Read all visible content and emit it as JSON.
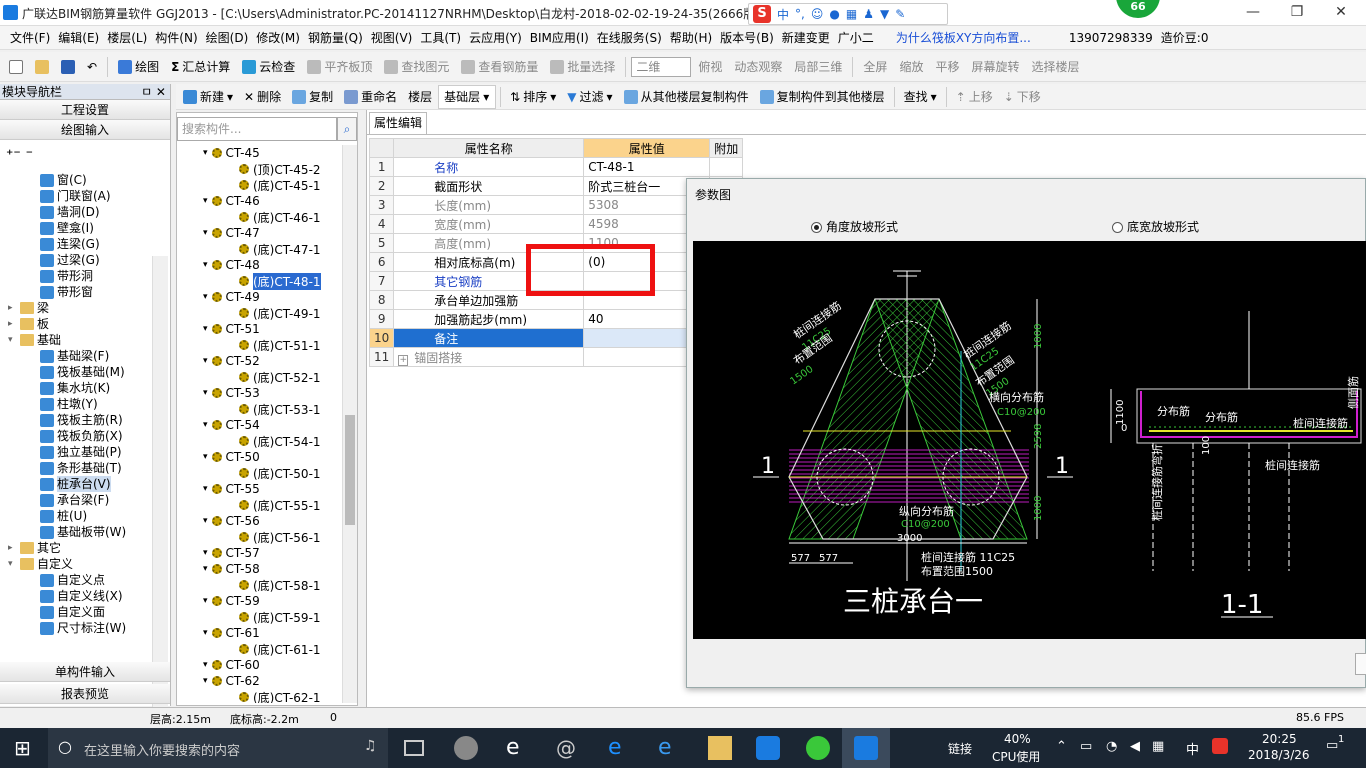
{
  "titlebar": {
    "title": "广联达BIM钢筋算量软件 GGJ2013 - [C:\\Users\\Administrator.PC-20141127NRHM\\Desktop\\白龙村-2018-02-02-19-24-35(2666版",
    "ime_items": [
      "中",
      "°,"
    ],
    "badge": "66",
    "min": "—",
    "max": "❐",
    "close": "✕"
  },
  "menu": {
    "items": [
      "文件(F)",
      "编辑(E)",
      "楼层(L)",
      "构件(N)",
      "绘图(D)",
      "修改(M)",
      "钢筋量(Q)",
      "视图(V)",
      "工具(T)",
      "云应用(Y)",
      "BIM应用(I)",
      "在线服务(S)",
      "帮助(H)",
      "版本号(B)",
      "新建变更",
      "广小二"
    ],
    "tip": "为什么筏板XY方向布置...",
    "phone": "13907298339",
    "price": "造价豆:0"
  },
  "toolbar1": {
    "draw": "绘图",
    "sum": "汇总计算",
    "cloud_check": "云检查",
    "align_top": "平齐板顶",
    "find_elem": "查找图元",
    "view_rebar": "查看钢筋量",
    "batch_select": "批量选择",
    "view_mode": "二维",
    "top_view": "俯视",
    "dynamic": "动态观察",
    "local3d": "局部三维",
    "fullscreen": "全屏",
    "zoom": "缩放",
    "pan": "平移",
    "rotate": "屏幕旋转",
    "select_floor": "选择楼层"
  },
  "toolbar2": {
    "new": "新建",
    "delete": "删除",
    "copy": "复制",
    "rename": "重命名",
    "floor_label": "楼层",
    "floor_value": "基础层",
    "sort": "排序",
    "filter": "过滤",
    "copy_from": "从其他楼层复制构件",
    "copy_to": "复制构件到其他楼层",
    "find": "查找",
    "up": "上移",
    "down": "下移"
  },
  "leftnav": {
    "header": "模块导航栏",
    "pin": "ㅁ ✕",
    "btn_project": "工程设置",
    "btn_draw": "绘图输入",
    "btn_single": "单构件输入",
    "btn_report": "报表预览",
    "tree": [
      {
        "label": "窗(C)",
        "indent": 2
      },
      {
        "label": "门联窗(A)",
        "indent": 2
      },
      {
        "label": "墙洞(D)",
        "indent": 2
      },
      {
        "label": "壁龛(I)",
        "indent": 2
      },
      {
        "label": "连梁(G)",
        "indent": 2
      },
      {
        "label": "过梁(G)",
        "indent": 2
      },
      {
        "label": "带形洞",
        "indent": 2
      },
      {
        "label": "带形窗",
        "indent": 2
      },
      {
        "label": "梁",
        "indent": 1,
        "folder": true,
        "toggle": ">"
      },
      {
        "label": "板",
        "indent": 1,
        "folder": true,
        "toggle": ">"
      },
      {
        "label": "基础",
        "indent": 1,
        "folder": true,
        "toggle": "v"
      },
      {
        "label": "基础梁(F)",
        "indent": 2
      },
      {
        "label": "筏板基础(M)",
        "indent": 2
      },
      {
        "label": "集水坑(K)",
        "indent": 2
      },
      {
        "label": "柱墩(Y)",
        "indent": 2
      },
      {
        "label": "筏板主筋(R)",
        "indent": 2
      },
      {
        "label": "筏板负筋(X)",
        "indent": 2
      },
      {
        "label": "独立基础(P)",
        "indent": 2
      },
      {
        "label": "条形基础(T)",
        "indent": 2
      },
      {
        "label": "桩承台(V)",
        "indent": 2,
        "selected": true
      },
      {
        "label": "承台梁(F)",
        "indent": 2
      },
      {
        "label": "桩(U)",
        "indent": 2
      },
      {
        "label": "基础板带(W)",
        "indent": 2
      },
      {
        "label": "其它",
        "indent": 1,
        "folder": true,
        "toggle": ">"
      },
      {
        "label": "自定义",
        "indent": 1,
        "folder": true,
        "toggle": "v"
      },
      {
        "label": "自定义点",
        "indent": 2
      },
      {
        "label": "自定义线(X)",
        "indent": 2
      },
      {
        "label": "自定义面",
        "indent": 2
      },
      {
        "label": "尺寸标注(W)",
        "indent": 2
      }
    ]
  },
  "ctree": {
    "search_placeholder": "搜索构件...",
    "items": [
      {
        "label": "CT-45",
        "level": 0
      },
      {
        "label": "(顶)CT-45-2",
        "level": 1
      },
      {
        "label": "(底)CT-45-1",
        "level": 1
      },
      {
        "label": "CT-46",
        "level": 0
      },
      {
        "label": "(底)CT-46-1",
        "level": 1
      },
      {
        "label": "CT-47",
        "level": 0
      },
      {
        "label": "(底)CT-47-1",
        "level": 1
      },
      {
        "label": "CT-48",
        "level": 0
      },
      {
        "label": "(底)CT-48-1",
        "level": 1,
        "selected": true
      },
      {
        "label": "CT-49",
        "level": 0
      },
      {
        "label": "(底)CT-49-1",
        "level": 1
      },
      {
        "label": "CT-51",
        "level": 0
      },
      {
        "label": "(底)CT-51-1",
        "level": 1
      },
      {
        "label": "CT-52",
        "level": 0
      },
      {
        "label": "(底)CT-52-1",
        "level": 1
      },
      {
        "label": "CT-53",
        "level": 0
      },
      {
        "label": "(底)CT-53-1",
        "level": 1
      },
      {
        "label": "CT-54",
        "level": 0
      },
      {
        "label": "(底)CT-54-1",
        "level": 1
      },
      {
        "label": "CT-50",
        "level": 0
      },
      {
        "label": "(底)CT-50-1",
        "level": 1
      },
      {
        "label": "CT-55",
        "level": 0
      },
      {
        "label": "(底)CT-55-1",
        "level": 1
      },
      {
        "label": "CT-56",
        "level": 0
      },
      {
        "label": "(底)CT-56-1",
        "level": 1
      },
      {
        "label": "CT-57",
        "level": 0
      },
      {
        "label": "CT-58",
        "level": 0
      },
      {
        "label": "(底)CT-58-1",
        "level": 1
      },
      {
        "label": "CT-59",
        "level": 0
      },
      {
        "label": "(底)CT-59-1",
        "level": 1
      },
      {
        "label": "CT-61",
        "level": 0
      },
      {
        "label": "(底)CT-61-1",
        "level": 1
      },
      {
        "label": "CT-60",
        "level": 0
      },
      {
        "label": "CT-62",
        "level": 0
      },
      {
        "label": "(底)CT-62-1",
        "level": 1
      }
    ]
  },
  "props": {
    "tab": "属性编辑",
    "col_name": "属性名称",
    "col_value": "属性值",
    "col_add": "附加",
    "rows": [
      {
        "no": "1",
        "name": "名称",
        "value": "CT-48-1",
        "style": "blue"
      },
      {
        "no": "2",
        "name": "截面形状",
        "value": "阶式三桩台一",
        "style": ""
      },
      {
        "no": "3",
        "name": "长度(mm)",
        "value": "5308",
        "style": "gray"
      },
      {
        "no": "4",
        "name": "宽度(mm)",
        "value": "4598",
        "style": "gray"
      },
      {
        "no": "5",
        "name": "高度(mm)",
        "value": "1100",
        "style": "gray"
      },
      {
        "no": "6",
        "name": "相对底标高(m)",
        "value": "(0)",
        "style": ""
      },
      {
        "no": "7",
        "name": "其它钢筋",
        "value": "",
        "style": "blue"
      },
      {
        "no": "8",
        "name": "承台单边加强筋",
        "value": "",
        "style": ""
      },
      {
        "no": "9",
        "name": "加强筋起步(mm)",
        "value": "40",
        "style": ""
      },
      {
        "no": "10",
        "name": "备注",
        "value": "",
        "style": "sel"
      },
      {
        "no": "11",
        "name": "锚固搭接",
        "value": "",
        "style": "gray",
        "expand": "+"
      }
    ]
  },
  "param": {
    "title": "参数图",
    "radio1": "角度放坡形式",
    "radio2": "底宽放坡形式",
    "caption_main": "三桩承台一",
    "caption_section": "1-1",
    "labels": {
      "l1": "桩间连接筋",
      "l1b": "11C25",
      "l1c": "布置范围",
      "l1d": "1500",
      "r1": "桩间连接筋",
      "r1b": "11C25",
      "r1c": "布置范围",
      "r1d": "1500",
      "hdist": "横向分布筋",
      "hdist_v": "C10@200",
      "vdist": "纵向分布筋",
      "vdist_v": "C10@200",
      "bot": "桩间连接筋 11C25",
      "bot2": "布置范围1500",
      "d1000a": "1000",
      "d2598": "2598",
      "d1000b": "1000",
      "d3000": "3000",
      "d577a": "577",
      "d577b": "577",
      "sec1": "1",
      "sec2": "1",
      "s_dist1": "分布筋",
      "s_dist2": "分布筋",
      "s_link": "桩间连接筋",
      "s_link2": "桩间连接筋",
      "s_1100": "1100",
      "s_0": "0",
      "s_100": "100",
      "s_side": "侧面筋",
      "s_left": "桩间连接筋弯折"
    }
  },
  "status": {
    "floor_h": "层高:2.15m",
    "bottom_h": "底标高:-2.2m",
    "zero": "0",
    "fps": "85.6 FPS"
  },
  "taskbar": {
    "search": "在这里输入你要搜索的内容",
    "link": "链接",
    "cpu_pct": "40%",
    "cpu": "CPU使用",
    "lang": "中",
    "time": "20:25",
    "date": "2018/3/26",
    "notif": "1"
  }
}
